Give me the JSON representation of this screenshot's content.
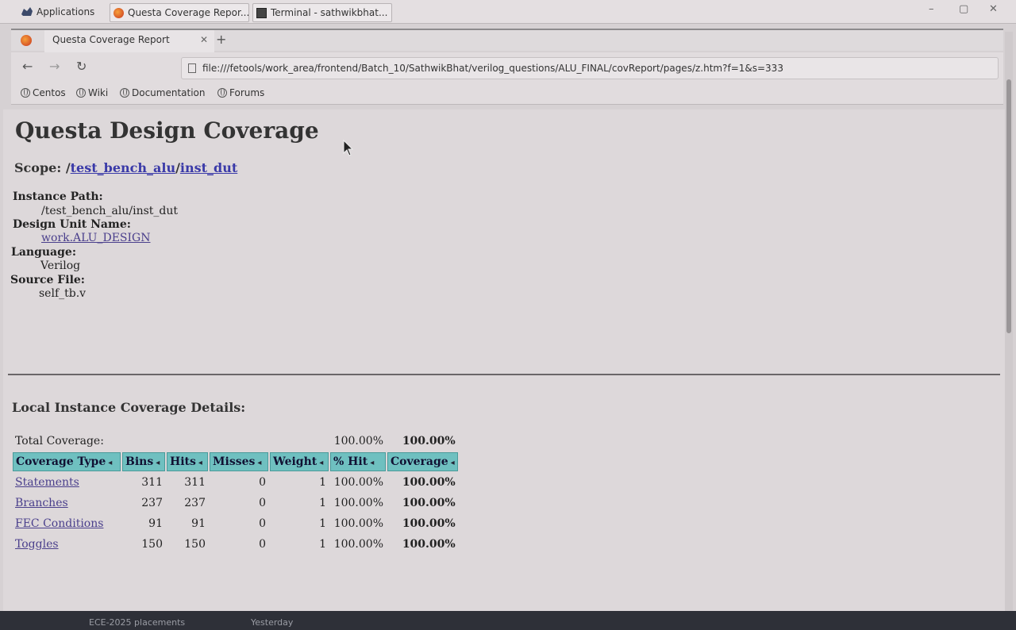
{
  "taskbar": {
    "applications_label": "Applications",
    "tasks": [
      {
        "label": "Questa Coverage Repor..."
      },
      {
        "label": "Terminal - sathwikbhat..."
      }
    ]
  },
  "browser": {
    "tab_title": "Questa Coverage Report",
    "url": "file:///fetools/work_area/frontend/Batch_10/SathwikBhat/verilog_questions/ALU_FINAL/covReport/pages/z.htm?f=1&s=333",
    "bookmarks": [
      "Centos",
      "Wiki",
      "Documentation",
      "Forums"
    ]
  },
  "page": {
    "heading": "Questa Design Coverage",
    "scope_label": "Scope: /",
    "scope_link1": "test_bench_alu",
    "scope_sep": "/",
    "scope_link2": "inst_dut",
    "instance_path_label": "Instance Path:",
    "instance_path": "/test_bench_alu/inst_dut",
    "design_unit_label": "Design Unit Name:",
    "design_unit": "work.ALU_DESIGN",
    "language_label": "Language:",
    "language": "Verilog",
    "source_file_label": "Source File:",
    "source_file": "self_tb.v",
    "details_heading": "Local Instance Coverage Details:"
  },
  "coverage": {
    "total_label": "Total Coverage:",
    "total_pct_hit": "100.00%",
    "total_coverage": "100.00%",
    "headers": [
      "Coverage Type",
      "Bins",
      "Hits",
      "Misses",
      "Weight",
      "% Hit",
      "Coverage"
    ],
    "rows": [
      {
        "type": "Statements",
        "bins": "311",
        "hits": "311",
        "misses": "0",
        "weight": "1",
        "pct_hit": "100.00%",
        "coverage": "100.00%"
      },
      {
        "type": "Branches",
        "bins": "237",
        "hits": "237",
        "misses": "0",
        "weight": "1",
        "pct_hit": "100.00%",
        "coverage": "100.00%"
      },
      {
        "type": "FEC Conditions",
        "bins": "91",
        "hits": "91",
        "misses": "0",
        "weight": "1",
        "pct_hit": "100.00%",
        "coverage": "100.00%"
      },
      {
        "type": "Toggles",
        "bins": "150",
        "hits": "150",
        "misses": "0",
        "weight": "1",
        "pct_hit": "100.00%",
        "coverage": "100.00%"
      }
    ]
  },
  "bottom_bar": {
    "left_text": "ECE-2025 placements",
    "right_text": "Yesterday"
  },
  "colors": {
    "header_teal": "#6fc0c0",
    "link": "#3a3aa8"
  }
}
